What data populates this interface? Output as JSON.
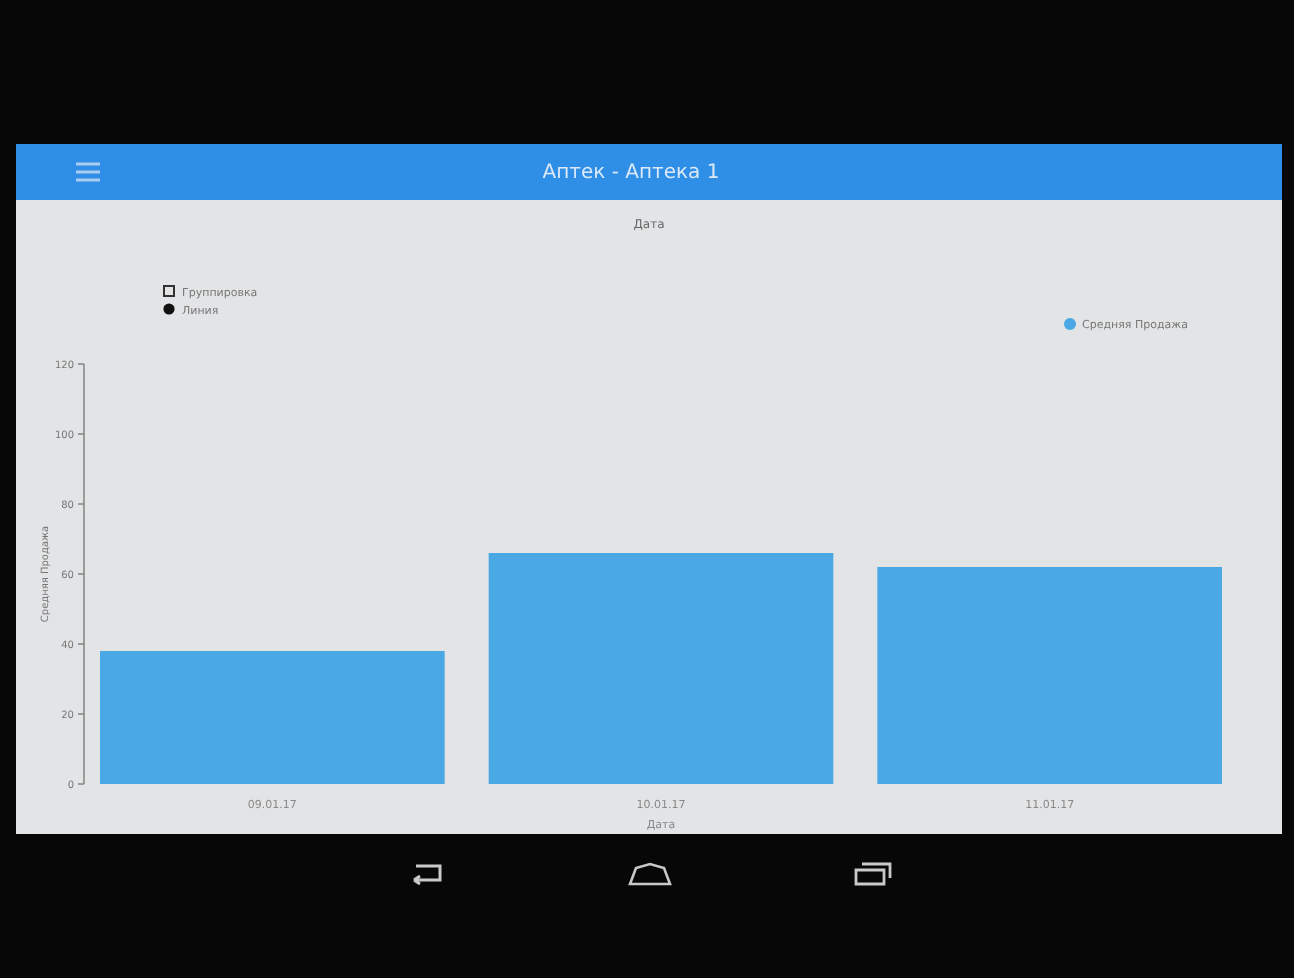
{
  "app_bar": {
    "title": "Аптек - Аптека 1"
  },
  "chart": {
    "chart_data": {
      "type": "bar",
      "title": "Дата",
      "xlabel": "Дата",
      "ylabel": "Средняя Продажа",
      "categories": [
        "09.01.17",
        "10.01.17",
        "11.01.17"
      ],
      "series": [
        {
          "name": "Средняя Продажа",
          "color": "#4aa8e4",
          "values": [
            38,
            66,
            62
          ]
        }
      ],
      "ylim": [
        0,
        120
      ],
      "yticks": [
        0,
        20,
        40,
        60,
        80,
        100,
        120
      ]
    },
    "legend_left": [
      {
        "label": "Группировка",
        "kind": "square"
      },
      {
        "label": "Линия",
        "kind": "dot"
      }
    ]
  }
}
